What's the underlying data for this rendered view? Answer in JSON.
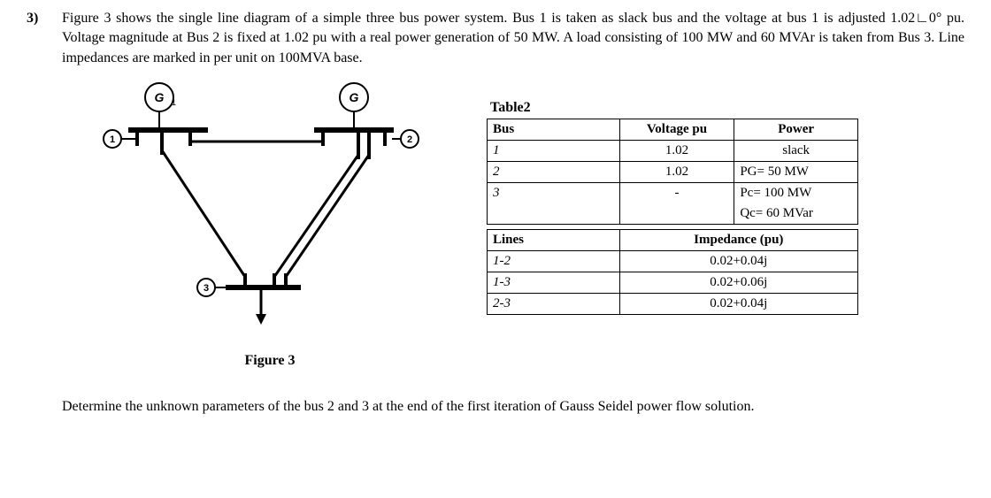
{
  "problem": {
    "number": "3)",
    "statement": "Figure 3 shows the single line diagram of a simple three bus power system. Bus 1 is taken as slack bus and the voltage at bus 1 is adjusted 1.02∟0° pu. Voltage magnitude at Bus 2 is fixed at 1.02 pu with a real power generation of 50 MW. A load consisting of 100 MW and 60 MVAr is taken from Bus 3. Line impedances are marked in per unit on 100MVA base.",
    "question": "Determine the unknown parameters of the bus 2 and 3 at the end of the first iteration of Gauss Seidel power flow solution."
  },
  "figure": {
    "caption": "Figure 3",
    "labels": {
      "g": "G",
      "g1sub": "1",
      "bus1": "1",
      "bus2": "2",
      "bus3": "3"
    }
  },
  "table": {
    "title": "Table2",
    "bus_header": {
      "c1": "Bus",
      "c2": "Voltage pu",
      "c3": "Power"
    },
    "bus_rows": [
      {
        "c1": "1",
        "c2": "1.02",
        "c3": "slack"
      },
      {
        "c1": "2",
        "c2": "1.02",
        "c3": "PG= 50 MW"
      },
      {
        "c1": "3",
        "c2": "-",
        "c3": "Pc= 100 MW"
      },
      {
        "c1": "",
        "c2": "",
        "c3": "Qc= 60 MVar"
      }
    ],
    "lines_header": {
      "c1": "Lines",
      "c2": "Impedance (pu)"
    },
    "lines_rows": [
      {
        "c1": "1-2",
        "c2": "0.02+0.04j"
      },
      {
        "c1": "1-3",
        "c2": "0.02+0.06j"
      },
      {
        "c1": "2-3",
        "c2": "0.02+0.04j"
      }
    ]
  },
  "chart_data": {
    "type": "table",
    "title": "Table2",
    "buses": [
      {
        "bus": 1,
        "voltage_pu": 1.02,
        "power": "slack"
      },
      {
        "bus": 2,
        "voltage_pu": 1.02,
        "power": {
          "PG_MW": 50
        }
      },
      {
        "bus": 3,
        "voltage_pu": null,
        "power": {
          "Pc_MW": 100,
          "Qc_MVar": 60
        }
      }
    ],
    "lines": [
      {
        "line": "1-2",
        "impedance_pu": {
          "r": 0.02,
          "x": 0.04
        }
      },
      {
        "line": "1-3",
        "impedance_pu": {
          "r": 0.02,
          "x": 0.06
        }
      },
      {
        "line": "2-3",
        "impedance_pu": {
          "r": 0.02,
          "x": 0.04
        }
      }
    ],
    "base_MVA": 100
  }
}
